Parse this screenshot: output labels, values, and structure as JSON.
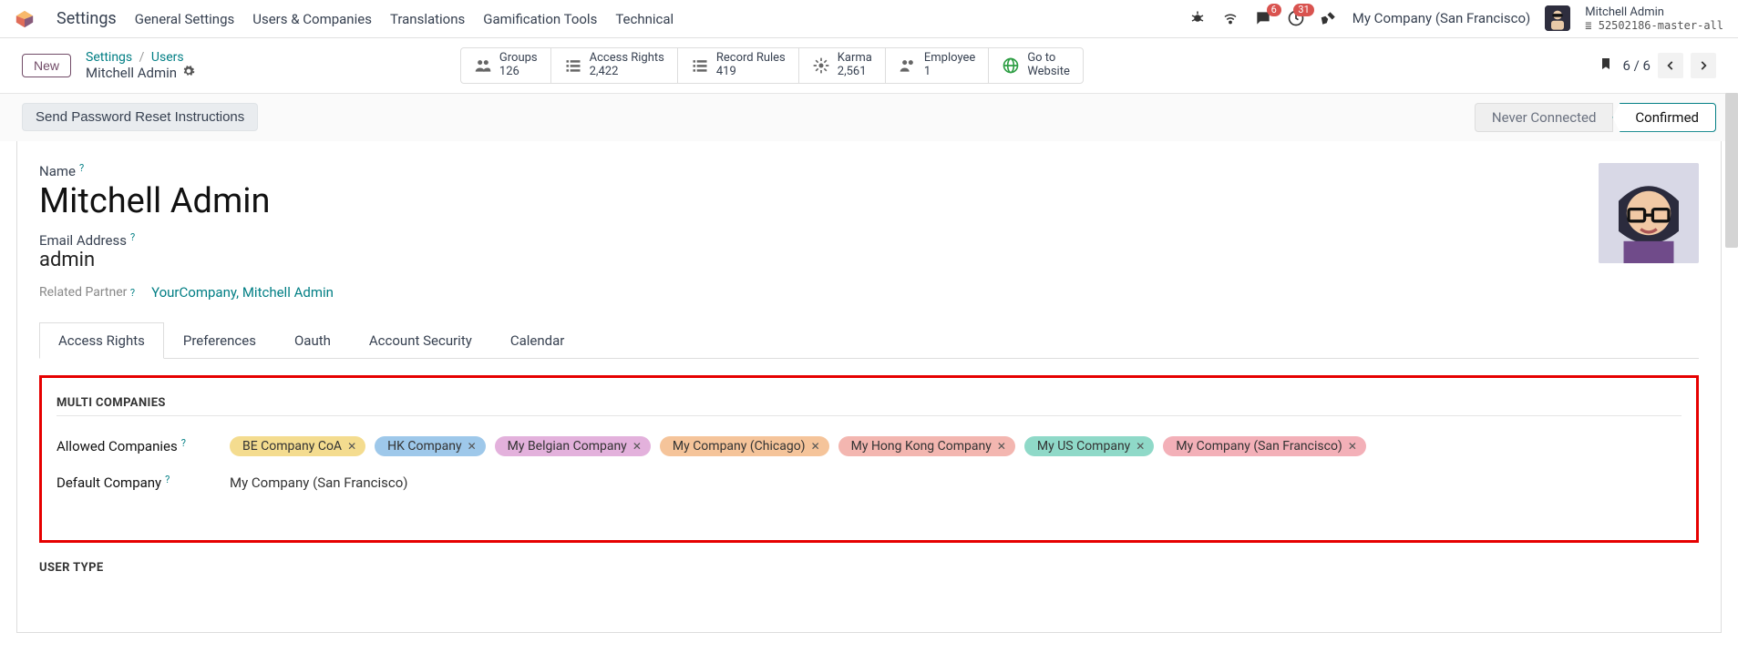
{
  "topnav": {
    "app": "Settings",
    "menus": [
      "General Settings",
      "Users & Companies",
      "Translations",
      "Gamification Tools",
      "Technical"
    ],
    "messages_badge": "6",
    "activities_badge": "31",
    "company": "My Company (San Francisco)",
    "user_name": "Mitchell Admin",
    "db_name": "52502186-master-all"
  },
  "control": {
    "new_label": "New",
    "crumb_root": "Settings",
    "crumb_parent": "Users",
    "crumb_current": "Mitchell Admin",
    "stats": [
      {
        "label": "Groups",
        "value": "126"
      },
      {
        "label": "Access Rights",
        "value": "2,422"
      },
      {
        "label": "Record Rules",
        "value": "419"
      },
      {
        "label": "Karma",
        "value": "2,561"
      },
      {
        "label": "Employee",
        "value": "1"
      },
      {
        "label": "Go to",
        "value": "Website"
      }
    ],
    "pager": "6 / 6"
  },
  "actionbar": {
    "reset_pw": "Send Password Reset Instructions",
    "status_inactive": "Never Connected",
    "status_active": "Confirmed"
  },
  "form": {
    "name_label": "Name",
    "name_value": "Mitchell Admin",
    "email_label": "Email Address",
    "email_value": "admin",
    "partner_label": "Related Partner",
    "partner_value": "YourCompany, Mitchell Admin",
    "tabs": [
      "Access Rights",
      "Preferences",
      "Oauth",
      "Account Security",
      "Calendar"
    ],
    "section_title": "MULTI COMPANIES",
    "allowed_label": "Allowed Companies",
    "default_label": "Default Company",
    "default_value": "My Company (San Francisco)",
    "allowed_tags": [
      {
        "label": "BE Company CoA",
        "bg": "#f4dc8f"
      },
      {
        "label": "HK Company",
        "bg": "#9ec8ea"
      },
      {
        "label": "My Belgian Company",
        "bg": "#e3b1dc"
      },
      {
        "label": "My Company (Chicago)",
        "bg": "#f5c49a"
      },
      {
        "label": "My Hong Kong Company",
        "bg": "#f3b6b0"
      },
      {
        "label": "My US Company",
        "bg": "#8fd9c8"
      },
      {
        "label": "My Company (San Francisco)",
        "bg": "#f3b0b8"
      }
    ],
    "usertype_title": "USER TYPE"
  }
}
